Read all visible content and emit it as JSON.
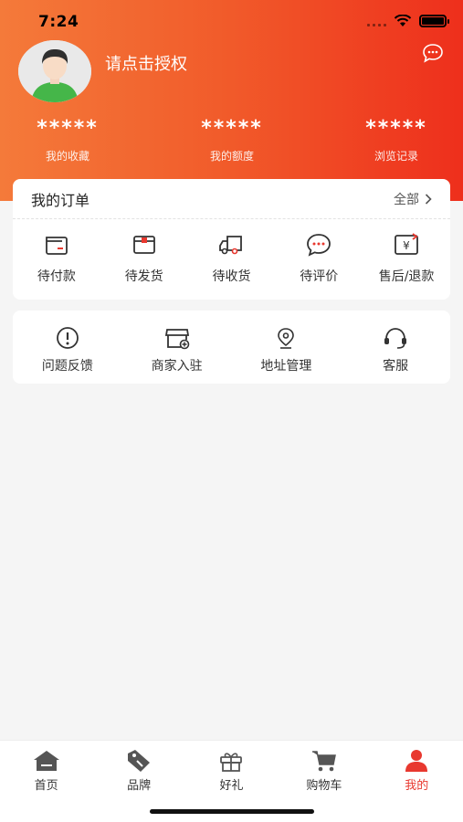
{
  "status": {
    "time": "7:24"
  },
  "profile": {
    "auth_prompt": "请点击授权"
  },
  "stats": [
    {
      "value": "*****",
      "label": "我的收藏"
    },
    {
      "value": "*****",
      "label": "我的额度"
    },
    {
      "value": "*****",
      "label": "浏览记录"
    }
  ],
  "orders": {
    "title": "我的订单",
    "all_label": "全部",
    "items": [
      {
        "label": "待付款",
        "icon": "wallet-icon"
      },
      {
        "label": "待发货",
        "icon": "package-icon"
      },
      {
        "label": "待收货",
        "icon": "truck-icon"
      },
      {
        "label": "待评价",
        "icon": "comment-icon"
      },
      {
        "label": "售后/退款",
        "icon": "refund-icon"
      }
    ]
  },
  "services": [
    {
      "label": "问题反馈",
      "icon": "feedback-icon"
    },
    {
      "label": "商家入驻",
      "icon": "store-icon"
    },
    {
      "label": "地址管理",
      "icon": "location-icon"
    },
    {
      "label": "客服",
      "icon": "headset-icon"
    }
  ],
  "tabbar": [
    {
      "label": "首页",
      "icon": "home-icon"
    },
    {
      "label": "品牌",
      "icon": "brand-tag-icon"
    },
    {
      "label": "好礼",
      "icon": "gift-icon"
    },
    {
      "label": "购物车",
      "icon": "cart-icon"
    },
    {
      "label": "我的",
      "icon": "user-icon",
      "active": true
    }
  ],
  "colors": {
    "header_start": "#f47a3a",
    "header_end": "#ee2f1c",
    "active_tab": "#e8382f"
  }
}
